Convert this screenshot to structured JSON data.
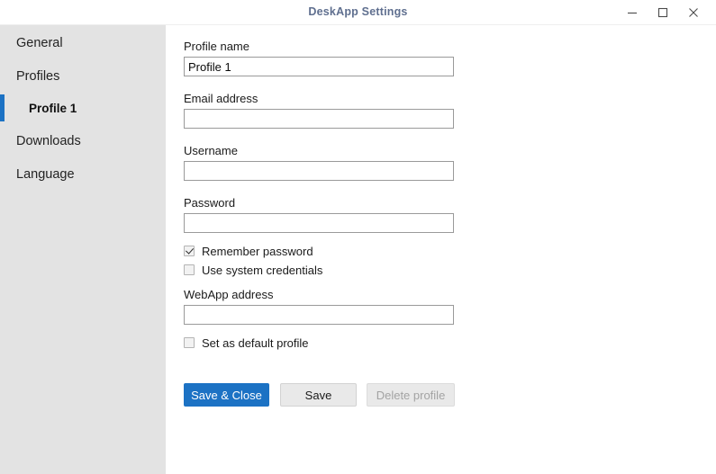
{
  "window": {
    "title": "DeskApp Settings",
    "controls": [
      {
        "name": "minimize",
        "glyph": "minimize-icon"
      },
      {
        "name": "maximize",
        "glyph": "maximize-icon"
      },
      {
        "name": "close",
        "glyph": "close-icon"
      }
    ]
  },
  "colors": {
    "accent": "#1c72c4",
    "sidebar_bg": "#e3e3e3",
    "content_bg": "#ffffff",
    "title_text": "#5f6f8f",
    "input_border": "#9a9a9a",
    "disabled_text": "#a3a3a3"
  },
  "sidebar": {
    "items": [
      {
        "label": "General",
        "level": 0,
        "selected": false
      },
      {
        "label": "Profiles",
        "level": 0,
        "selected": false
      },
      {
        "label": "Profile 1",
        "level": 1,
        "selected": true
      },
      {
        "label": "Downloads",
        "level": 0,
        "selected": false
      },
      {
        "label": "Language",
        "level": 0,
        "selected": false
      }
    ]
  },
  "form": {
    "fields": [
      {
        "label": "Profile name",
        "value": "Profile 1",
        "placeholder": ""
      },
      {
        "label": "Email address",
        "value": "",
        "placeholder": ""
      },
      {
        "label": "Username",
        "value": "",
        "placeholder": ""
      },
      {
        "label": "Password",
        "value": "",
        "placeholder": ""
      },
      {
        "label": "WebApp address",
        "value": "",
        "placeholder": ""
      }
    ],
    "checkboxes": [
      {
        "label": "Remember password",
        "checked": true
      },
      {
        "label": "Use system credentials",
        "checked": false
      },
      {
        "label": "Set as default profile",
        "checked": false
      }
    ]
  },
  "buttons": {
    "save_close": "Save & Close",
    "save": "Save",
    "delete_profile": "Delete profile"
  }
}
